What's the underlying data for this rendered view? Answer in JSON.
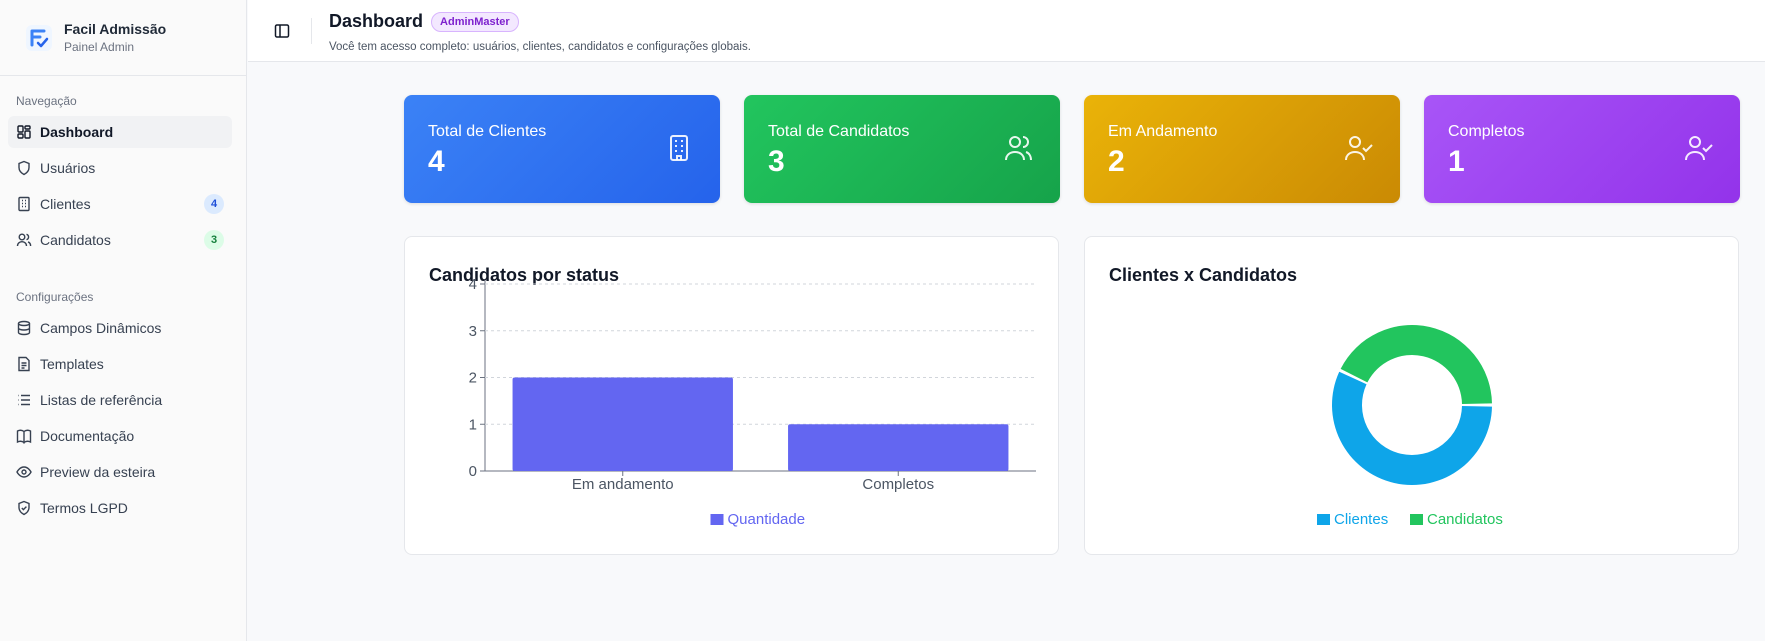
{
  "brand": {
    "name": "Facil Admissão",
    "subtitle": "Painel Admin"
  },
  "sidebar": {
    "nav_section": "Navegação",
    "nav_items": [
      {
        "label": "Dashboard",
        "icon": "dashboard-icon",
        "active": true
      },
      {
        "label": "Usuários",
        "icon": "shield-icon"
      },
      {
        "label": "Clientes",
        "icon": "building-icon",
        "badge": "4"
      },
      {
        "label": "Candidatos",
        "icon": "users-icon",
        "badge": "3"
      }
    ],
    "config_section": "Configurações",
    "config_items": [
      {
        "label": "Campos Dinâmicos",
        "icon": "database-icon"
      },
      {
        "label": "Templates",
        "icon": "file-icon"
      },
      {
        "label": "Listas de referência",
        "icon": "list-icon"
      },
      {
        "label": "Documentação",
        "icon": "book-icon"
      },
      {
        "label": "Preview da esteira",
        "icon": "eye-icon"
      },
      {
        "label": "Termos LGPD",
        "icon": "shield-check-icon"
      }
    ]
  },
  "header": {
    "title": "Dashboard",
    "role_badge": "AdminMaster",
    "description": "Você tem acesso completo: usuários, clientes, candidatos e configurações globais."
  },
  "stats": [
    {
      "label": "Total de Clientes",
      "value": "4",
      "icon": "building-icon",
      "color": "#3b82f6"
    },
    {
      "label": "Total de Candidatos",
      "value": "3",
      "icon": "users-icon",
      "color": "#22c55e"
    },
    {
      "label": "Em Andamento",
      "value": "2",
      "icon": "user-check-icon",
      "color": "#eab308"
    },
    {
      "label": "Completos",
      "value": "1",
      "icon": "user-check-icon",
      "color": "#a855f7"
    }
  ],
  "chart_data": [
    {
      "type": "bar",
      "title": "Candidatos por status",
      "categories": [
        "Em andamento",
        "Completos"
      ],
      "series": [
        {
          "name": "Quantidade",
          "values": [
            2,
            1
          ],
          "color": "#6366f1"
        }
      ],
      "ylim": [
        0,
        4
      ],
      "yticks": [
        "0",
        "1",
        "2",
        "3",
        "4"
      ],
      "grid": true,
      "legend": "bottom"
    },
    {
      "type": "pie",
      "title": "Clientes x Candidatos",
      "donut": true,
      "labels": [
        "Clientes",
        "Candidatos"
      ],
      "values": [
        4,
        3
      ],
      "colors": [
        "#0ea5e9",
        "#22c55e"
      ],
      "legend": "bottom"
    }
  ]
}
